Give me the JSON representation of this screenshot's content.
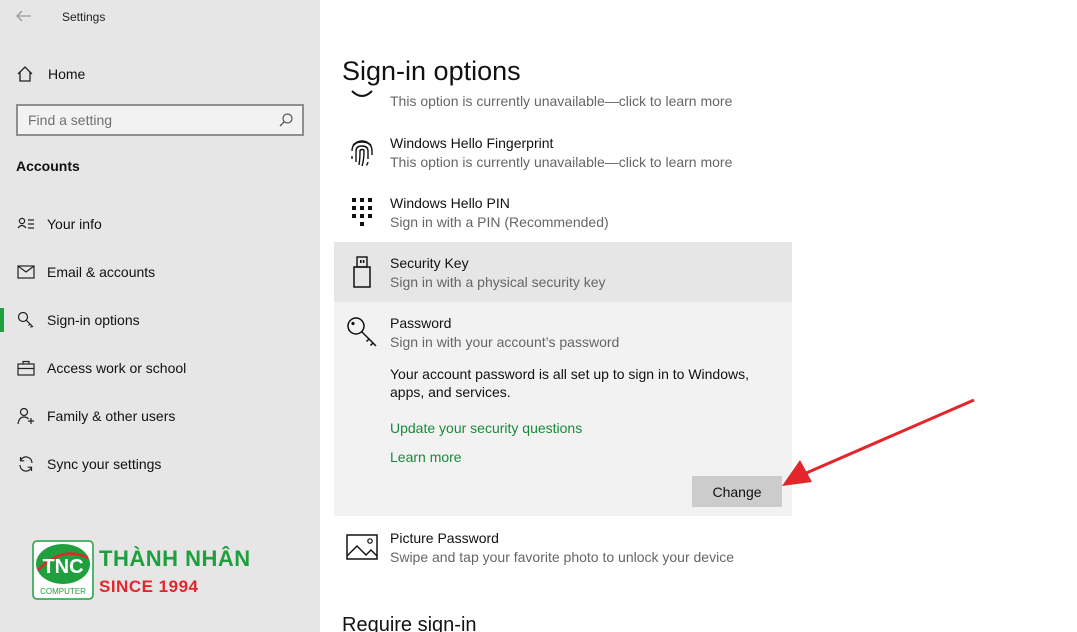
{
  "window": {
    "title": "Settings"
  },
  "sidebar": {
    "home_label": "Home",
    "search_placeholder": "Find a setting",
    "section": "Accounts",
    "items": [
      {
        "label": "Your info",
        "icon": "contact-card-icon"
      },
      {
        "label": "Email & accounts",
        "icon": "mail-icon"
      },
      {
        "label": "Sign-in options",
        "icon": "key-icon",
        "active": true
      },
      {
        "label": "Access work or school",
        "icon": "briefcase-icon"
      },
      {
        "label": "Family & other users",
        "icon": "person-add-icon"
      },
      {
        "label": "Sync your settings",
        "icon": "sync-icon"
      }
    ]
  },
  "logo": {
    "name": "THÀNH NHÂN",
    "since": "SINCE 1994",
    "badge_text": "TNC",
    "badge_sub": "COMPUTER"
  },
  "main": {
    "title": "Sign-in options",
    "options": [
      {
        "title": "",
        "subtitle": "This option is currently unavailable—click to learn more",
        "icon": "face-icon"
      },
      {
        "title": "Windows Hello Fingerprint",
        "subtitle": "This option is currently unavailable—click to learn more",
        "icon": "fingerprint-icon"
      },
      {
        "title": "Windows Hello PIN",
        "subtitle": "Sign in with a PIN (Recommended)",
        "icon": "pin-keypad-icon"
      },
      {
        "title": "Security Key",
        "subtitle": "Sign in with a physical security key",
        "icon": "usb-key-icon"
      },
      {
        "title": "Password",
        "subtitle": "Sign in with your account’s password",
        "icon": "key-icon"
      },
      {
        "title": "Picture Password",
        "subtitle": "Swipe and tap your favorite photo to unlock your device",
        "icon": "picture-icon"
      }
    ],
    "password": {
      "description": "Your account password is all set up to sign in to Windows, apps, and services.",
      "link_security_questions": "Update your security questions",
      "link_learn_more": "Learn more",
      "change_label": "Change"
    },
    "require_heading": "Require sign-in"
  },
  "colors": {
    "accent": "#1f9f3e",
    "link": "#1a8a3a",
    "annotation_arrow": "#e3262b",
    "sidebar_bg": "#e6e6e6"
  }
}
